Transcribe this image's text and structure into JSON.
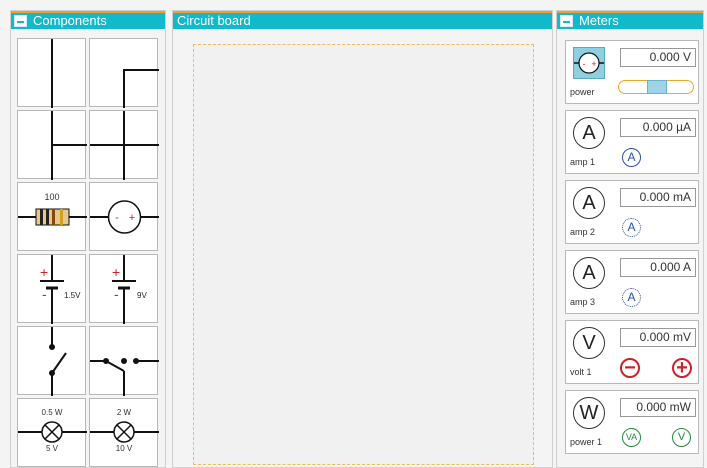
{
  "panels": {
    "components": {
      "title": "Components"
    },
    "board": {
      "title": "Circuit board"
    },
    "meters": {
      "title": "Meters"
    }
  },
  "components": {
    "resistor_label": "100",
    "battery1_label": "1.5V",
    "battery2_label": "9V",
    "lamp1_watt": "0.5 W",
    "lamp1_volt": "5 V",
    "lamp2_watt": "2 W",
    "lamp2_volt": "10 V"
  },
  "meters": [
    {
      "label": "power",
      "reading": "0.000 V",
      "symbol": ""
    },
    {
      "label": "amp 1",
      "reading": "0.000 µA",
      "symbol": "A",
      "small": "A"
    },
    {
      "label": "amp 2",
      "reading": "0.000 mA",
      "symbol": "A",
      "small": "A"
    },
    {
      "label": "amp 3",
      "reading": "0.000 A",
      "symbol": "A",
      "small": "A"
    },
    {
      "label": "volt 1",
      "reading": "0.000 mV",
      "symbol": "V"
    },
    {
      "label": "power 1",
      "reading": "0.000 mW",
      "symbol": "W",
      "small_left": "VA",
      "small_right": "V"
    }
  ],
  "colors": {
    "accent": "#11b9cc",
    "orange": "#f0a030",
    "blue": "#2a4fa8",
    "red": "#d0202a",
    "green": "#1f8a3a"
  }
}
